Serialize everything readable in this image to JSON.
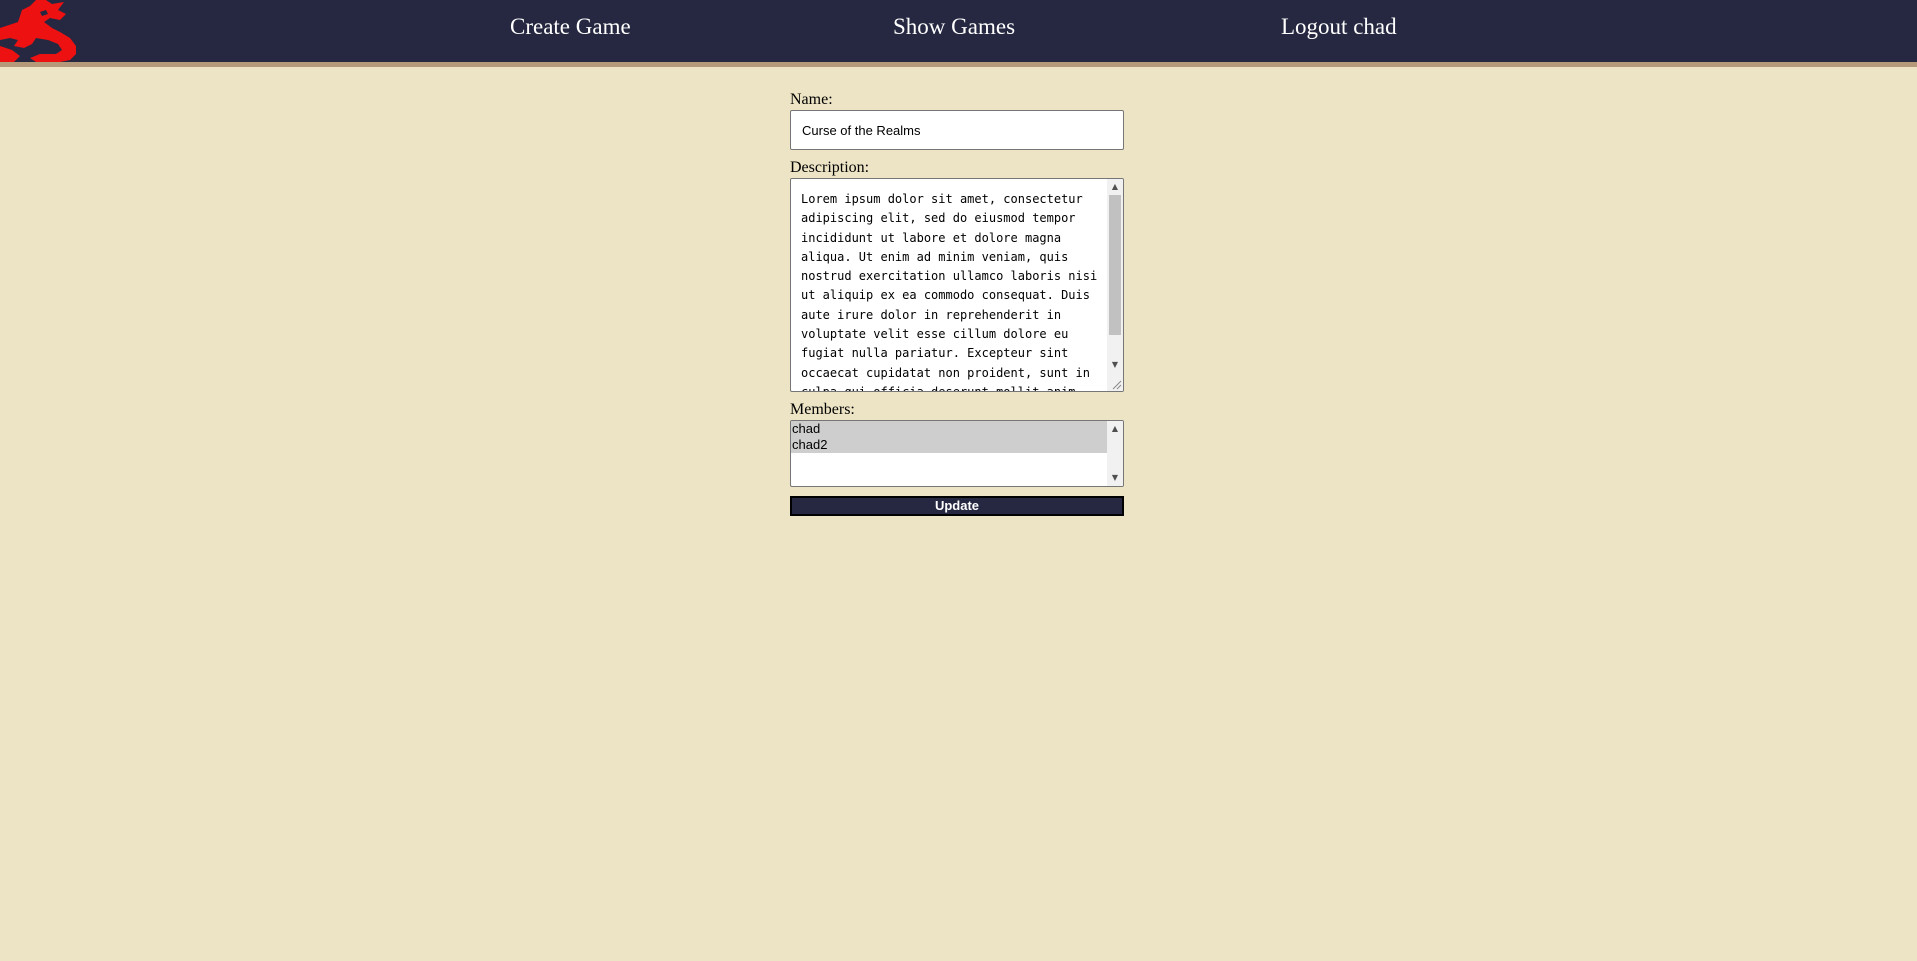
{
  "nav": {
    "create_game": "Create Game",
    "show_games": "Show Games",
    "logout": "Logout chad"
  },
  "form": {
    "name_label": "Name:",
    "name_value": "Curse of the Realms",
    "description_label": "Description:",
    "description_value": "Lorem ipsum dolor sit amet, consectetur adipiscing elit, sed do eiusmod tempor incididunt ut labore et dolore magna aliqua. Ut enim ad minim veniam, quis nostrud exercitation ullamco laboris nisi ut aliquip ex ea commodo consequat. Duis aute irure dolor in reprehenderit in voluptate velit esse cillum dolore eu fugiat nulla pariatur. Excepteur sint occaecat cupidatat non proident, sunt in culpa qui officia deserunt mollit anim",
    "members_label": "Members:",
    "members": [
      "chad",
      "chad2"
    ],
    "update_label": "Update"
  },
  "colors": {
    "background": "#ede4c5",
    "navbar": "#252840",
    "navbar_border": "#b59a7a",
    "logo": "#ee1111",
    "selected_option": "#cecece"
  },
  "icons": {
    "logo": "red-dragon-logo",
    "scroll_up": "scroll-up-arrow-icon",
    "scroll_down": "scroll-down-arrow-icon",
    "resize": "resize-grip-icon"
  }
}
